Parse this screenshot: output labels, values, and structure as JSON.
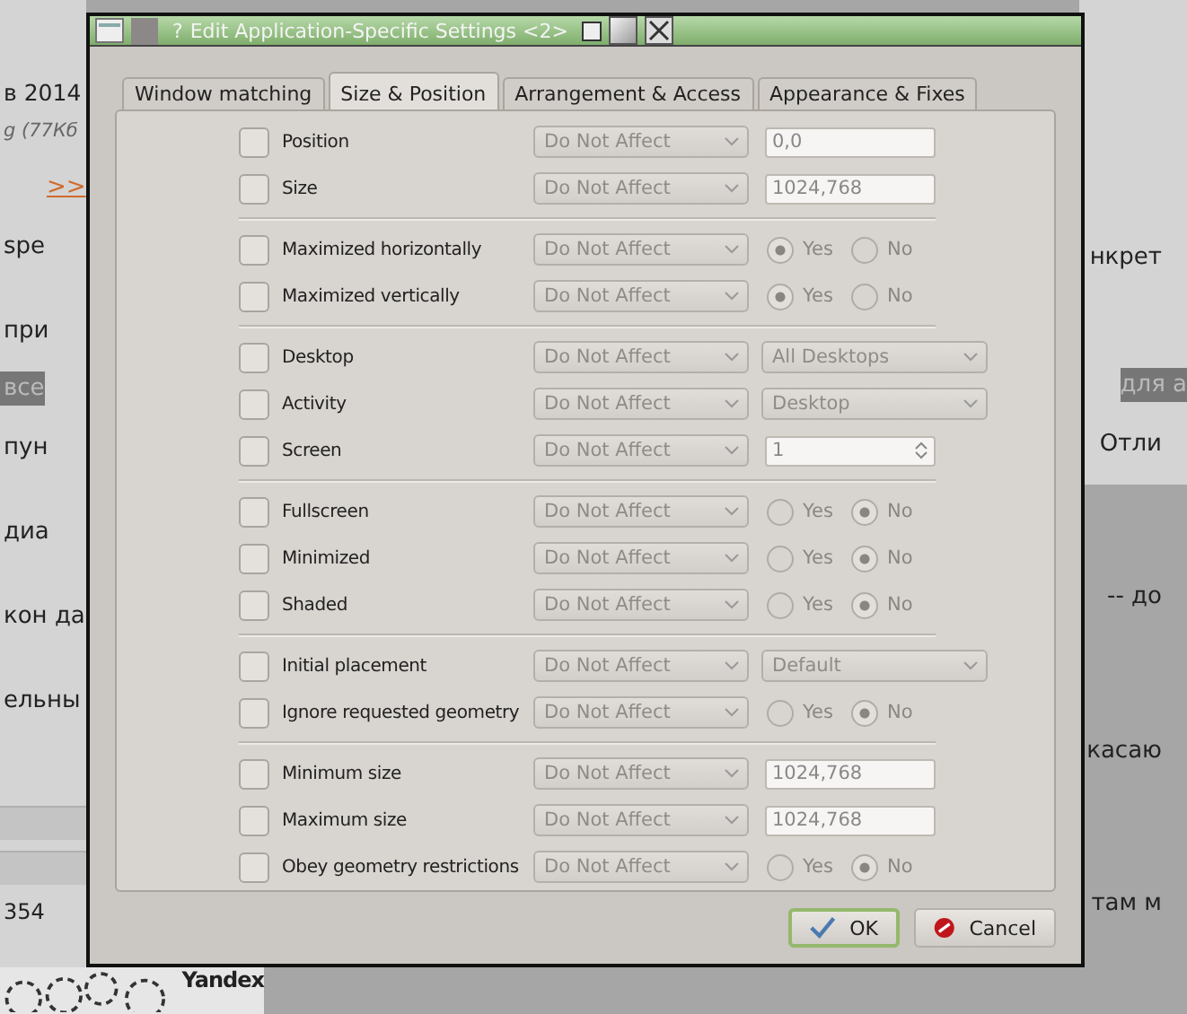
{
  "background_page": {
    "left_texts": [
      {
        "text": "в 2014",
        "kind": "heading"
      },
      {
        "text": "g (77Кб",
        "kind": "meta"
      },
      {
        "text": ">>",
        "kind": "link"
      },
      {
        "text": "spe",
        "kind": "body"
      },
      {
        "text": "при",
        "kind": "body"
      },
      {
        "text": "все",
        "kind": "highlight"
      },
      {
        "text": "пун",
        "kind": "body"
      },
      {
        "text": "диа",
        "kind": "body"
      },
      {
        "text": "кон да",
        "kind": "body"
      },
      {
        "text": "ельны",
        "kind": "body"
      }
    ],
    "left_footer": "354",
    "right_texts": [
      {
        "text": "нкрет",
        "kind": "body"
      },
      {
        "text": "для а",
        "kind": "highlight"
      },
      {
        "text": "Отли",
        "kind": "body"
      },
      {
        "text": "-- до",
        "kind": "body"
      },
      {
        "text": "касаю",
        "kind": "body"
      },
      {
        "text": "там м",
        "kind": "body"
      }
    ],
    "captcha_brand": "Yandex"
  },
  "window": {
    "title": "Edit Application-Specific Settings <2>",
    "help_button": "?"
  },
  "tabs": [
    {
      "label": "Window matching",
      "selected": false
    },
    {
      "label": "Size & Position",
      "selected": true
    },
    {
      "label": "Arrangement & Access",
      "selected": false
    },
    {
      "label": "Appearance & Fixes",
      "selected": false
    }
  ],
  "groups": [
    {
      "rows": [
        {
          "label": "Position",
          "checked": false,
          "policy": "Do Not Affect",
          "kind": "text",
          "value": "0,0"
        },
        {
          "label": "Size",
          "checked": false,
          "policy": "Do Not Affect",
          "kind": "text",
          "value": "1024,768"
        }
      ]
    },
    {
      "rows": [
        {
          "label": "Maximized horizontally",
          "checked": false,
          "policy": "Do Not Affect",
          "kind": "radio",
          "options": [
            {
              "label": "Yes",
              "selected": true
            },
            {
              "label": "No",
              "selected": false
            }
          ]
        },
        {
          "label": "Maximized vertically",
          "checked": false,
          "policy": "Do Not Affect",
          "kind": "radio",
          "options": [
            {
              "label": "Yes",
              "selected": true
            },
            {
              "label": "No",
              "selected": false
            }
          ]
        }
      ]
    },
    {
      "rows": [
        {
          "label": "Desktop",
          "checked": false,
          "policy": "Do Not Affect",
          "kind": "combo",
          "value": "All Desktops"
        },
        {
          "label": "Activity",
          "checked": false,
          "policy": "Do Not Affect",
          "kind": "combo",
          "value": "Desktop"
        },
        {
          "label": "Screen",
          "checked": false,
          "policy": "Do Not Affect",
          "kind": "spin",
          "value": "1"
        }
      ]
    },
    {
      "rows": [
        {
          "label": "Fullscreen",
          "checked": false,
          "policy": "Do Not Affect",
          "kind": "radio",
          "options": [
            {
              "label": "Yes",
              "selected": false
            },
            {
              "label": "No",
              "selected": true
            }
          ]
        },
        {
          "label": "Minimized",
          "checked": false,
          "policy": "Do Not Affect",
          "kind": "radio",
          "options": [
            {
              "label": "Yes",
              "selected": false
            },
            {
              "label": "No",
              "selected": true
            }
          ]
        },
        {
          "label": "Shaded",
          "checked": false,
          "policy": "Do Not Affect",
          "kind": "radio",
          "options": [
            {
              "label": "Yes",
              "selected": false
            },
            {
              "label": "No",
              "selected": true
            }
          ]
        }
      ]
    },
    {
      "rows": [
        {
          "label": "Initial placement",
          "checked": false,
          "policy": "Do Not Affect",
          "kind": "combo",
          "value": "Default"
        },
        {
          "label": "Ignore requested geometry",
          "checked": false,
          "policy": "Do Not Affect",
          "kind": "radio",
          "options": [
            {
              "label": "Yes",
              "selected": false
            },
            {
              "label": "No",
              "selected": true
            }
          ]
        }
      ]
    },
    {
      "rows": [
        {
          "label": "Minimum size",
          "checked": false,
          "policy": "Do Not Affect",
          "kind": "text",
          "value": "1024,768"
        },
        {
          "label": "Maximum size",
          "checked": false,
          "policy": "Do Not Affect",
          "kind": "text",
          "value": "1024,768"
        },
        {
          "label": "Obey geometry restrictions",
          "checked": false,
          "policy": "Do Not Affect",
          "kind": "radio",
          "options": [
            {
              "label": "Yes",
              "selected": false
            },
            {
              "label": "No",
              "selected": true
            }
          ]
        }
      ]
    }
  ],
  "buttons": [
    {
      "label": "OK",
      "kind": "ok"
    },
    {
      "label": "Cancel",
      "kind": "cancel"
    }
  ]
}
